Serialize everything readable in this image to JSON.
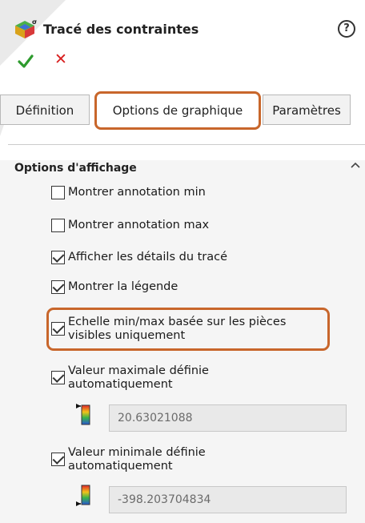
{
  "header": {
    "title": "Tracé des contraintes",
    "app_icon": "stress-plot-icon",
    "help_label": "?"
  },
  "actions": {
    "ok_icon": "checkmark-icon",
    "cancel_icon": "close-icon",
    "cancel_glyph": "✕",
    "ok_color": "#2e9b2e",
    "cancel_color": "#d81e1e"
  },
  "tabs": [
    {
      "label": "Définition",
      "active": false
    },
    {
      "label": "Options de graphique",
      "active": true
    },
    {
      "label": "Paramètres",
      "active": false
    }
  ],
  "section": {
    "title": "Options d'affichage",
    "collapse_icon": "chevron-up-icon"
  },
  "options": [
    {
      "label": "Montrer annotation min",
      "checked": false
    },
    {
      "label": "Montrer annotation max",
      "checked": false
    },
    {
      "label": "Afficher les détails du tracé",
      "checked": true
    },
    {
      "label": "Montrer la légende",
      "checked": true
    },
    {
      "label_line1": "Echelle min/max basée sur les pièces",
      "label_line2": "visibles uniquement",
      "checked": true
    },
    {
      "label_line1": "Valeur maximale définie",
      "label_line2": "automatiquement",
      "checked": true
    },
    {
      "label_line1": "Valeur minimale définie",
      "label_line2": "automatiquement",
      "checked": true
    }
  ],
  "max_value": {
    "icon": "legend-max-icon",
    "value": "20.63021088"
  },
  "min_value": {
    "icon": "legend-min-icon",
    "value": "-398.203704834"
  },
  "accent_color": "#c8662b"
}
